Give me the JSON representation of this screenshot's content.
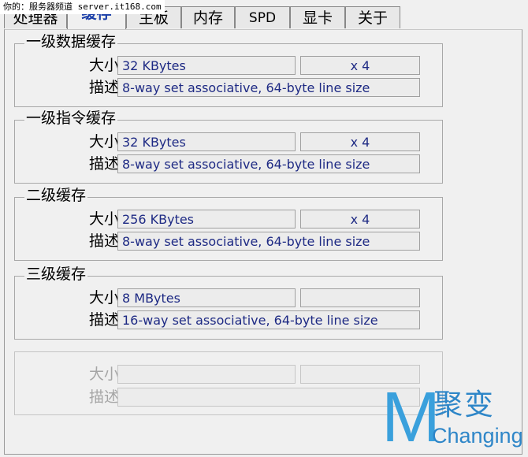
{
  "watermark": "你的：服务器频道 server.it168.com",
  "tabs": [
    {
      "label": "处理器",
      "active": false
    },
    {
      "label": "缓存",
      "active": true
    },
    {
      "label": "主板",
      "active": false
    },
    {
      "label": "内存",
      "active": false
    },
    {
      "label": "SPD",
      "active": false
    },
    {
      "label": "显卡",
      "active": false
    },
    {
      "label": "关于",
      "active": false
    }
  ],
  "groups": [
    {
      "title": "一级数据缓存",
      "size_label": "大小",
      "desc_label": "描述",
      "size": "32 KBytes",
      "mult": "x 4",
      "desc": "8-way set associative, 64-byte line size"
    },
    {
      "title": "一级指令缓存",
      "size_label": "大小",
      "desc_label": "描述",
      "size": "32 KBytes",
      "mult": "x 4",
      "desc": "8-way set associative, 64-byte line size"
    },
    {
      "title": "二级缓存",
      "size_label": "大小",
      "desc_label": "描述",
      "size": "256 KBytes",
      "mult": "x 4",
      "desc": "8-way set associative, 64-byte line size"
    },
    {
      "title": "三级缓存",
      "size_label": "大小",
      "desc_label": "描述",
      "size": "8 MBytes",
      "mult": "",
      "desc": "16-way set associative, 64-byte line size"
    },
    {
      "title": "",
      "size_label": "大小",
      "desc_label": "描述",
      "size": "",
      "mult": "",
      "desc": ""
    }
  ],
  "logo": {
    "letter": "M",
    "cn": "聚变",
    "en": "Changing"
  },
  "colors": {
    "field_text": "#1e2a84",
    "active_tab": "#1a3ea8",
    "logo": "#3aa0dc"
  }
}
